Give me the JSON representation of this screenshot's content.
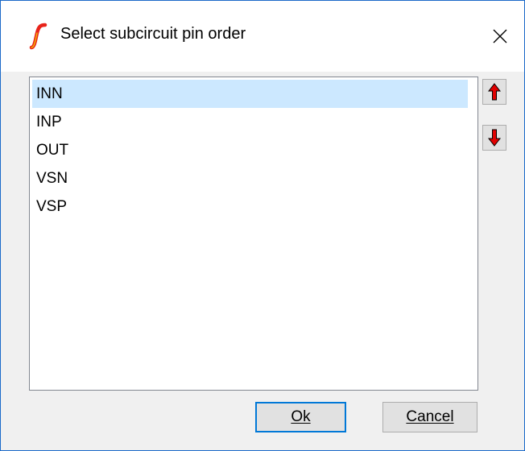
{
  "window": {
    "title": "Select subcircuit pin order",
    "close_glyph": "✕",
    "accent_color": "#1b6ac9"
  },
  "pins": [
    {
      "label": "INN",
      "selected": true
    },
    {
      "label": "INP",
      "selected": false
    },
    {
      "label": "OUT",
      "selected": false
    },
    {
      "label": "VSN",
      "selected": false
    },
    {
      "label": "VSP",
      "selected": false
    }
  ],
  "buttons": {
    "move_up_icon": "red-up-arrow",
    "move_down_icon": "red-down-arrow",
    "ok_label": "Ok",
    "cancel_label": "Cancel"
  },
  "colors": {
    "selection": "#cce8ff",
    "arrow": "#e10000",
    "default_button_border": "#0078d7"
  }
}
